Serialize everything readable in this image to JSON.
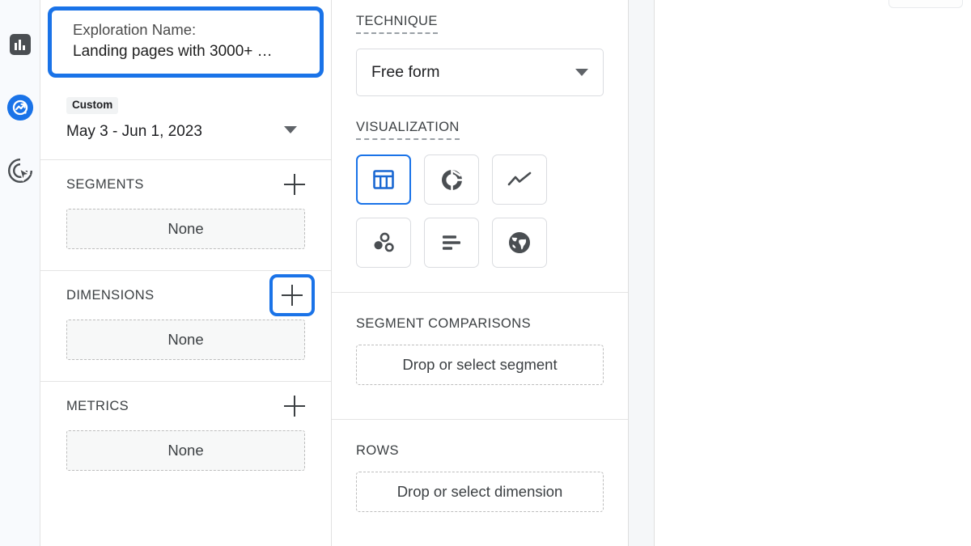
{
  "rail": {
    "items": [
      {
        "name": "reports-badge-icon",
        "icon": "bar-chart-badge-icon"
      },
      {
        "name": "explore-icon",
        "icon": "explore-trending-icon"
      },
      {
        "name": "advertising-icon",
        "icon": "target-cursor-icon"
      }
    ]
  },
  "variables": {
    "name_card": {
      "label": "Exploration Name:",
      "value": "Landing pages with 3000+ …"
    },
    "date_range": {
      "chip": "Custom",
      "value": "May 3 - Jun 1, 2023",
      "caret": "chevron-down-icon"
    },
    "sections": [
      {
        "title": "SEGMENTS",
        "add_icon": "plus-icon",
        "empty": "None",
        "highlighted": false
      },
      {
        "title": "DIMENSIONS",
        "add_icon": "plus-icon",
        "empty": "None",
        "highlighted": true
      },
      {
        "title": "METRICS",
        "add_icon": "plus-icon",
        "empty": "None",
        "highlighted": false
      }
    ]
  },
  "settings": {
    "technique": {
      "label": "TECHNIQUE",
      "value": "Free form",
      "caret": "chevron-down-icon"
    },
    "visualization": {
      "label": "VISUALIZATION",
      "options": [
        {
          "name": "free-form-table-icon",
          "selected": true
        },
        {
          "name": "donut-chart-icon",
          "selected": false
        },
        {
          "name": "line-chart-icon",
          "selected": false
        },
        {
          "name": "scatter-chart-icon",
          "selected": false
        },
        {
          "name": "bar-chart-icon",
          "selected": false
        },
        {
          "name": "geo-map-icon",
          "selected": false
        }
      ]
    },
    "segment_comparisons": {
      "label": "SEGMENT COMPARISONS",
      "placeholder": "Drop or select segment"
    },
    "rows": {
      "label": "ROWS",
      "placeholder": "Drop or select dimension"
    }
  },
  "colors": {
    "accent_blue": "#1a73e8",
    "icon_gray": "#4a4e52",
    "panel_bg": "#ffffff",
    "rail_bg": "#f8fafd",
    "gutter_bg": "#f5f7f9"
  }
}
